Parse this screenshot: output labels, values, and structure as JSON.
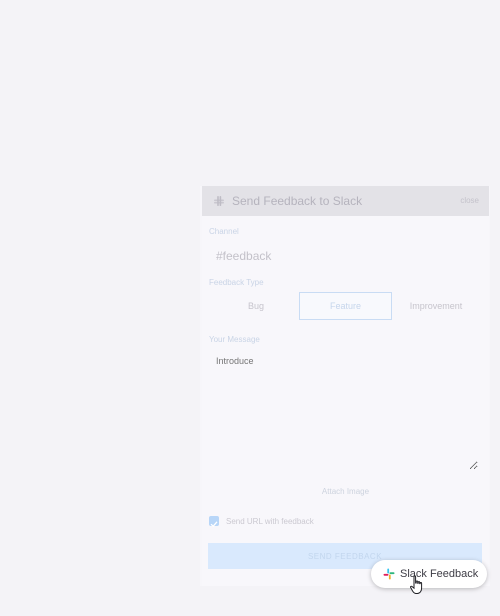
{
  "dialog": {
    "title": "Send Feedback to Slack",
    "close_label": "close",
    "channel_label": "Channel",
    "channel_value": "#feedback",
    "feedback_type_label": "Feedback Type",
    "feedback_types": [
      "Bug",
      "Feature",
      "Improvement"
    ],
    "selected_type": "Feature",
    "message_label": "Your Message",
    "message_placeholder": "Introduce",
    "attach_label": "Attach Image",
    "checkbox_label": "Send URL with feedback",
    "checkbox_checked": true,
    "send_label": "SEND FEEDBACK"
  },
  "launcher": {
    "label": "Slack Feedback",
    "icon": "slack-icon"
  },
  "colors": {
    "accent": "#1a82e2",
    "slack_red": "#e01e5a",
    "slack_green": "#2eb67d",
    "slack_blue": "#36c5f0",
    "slack_yellow": "#ecb22e"
  }
}
